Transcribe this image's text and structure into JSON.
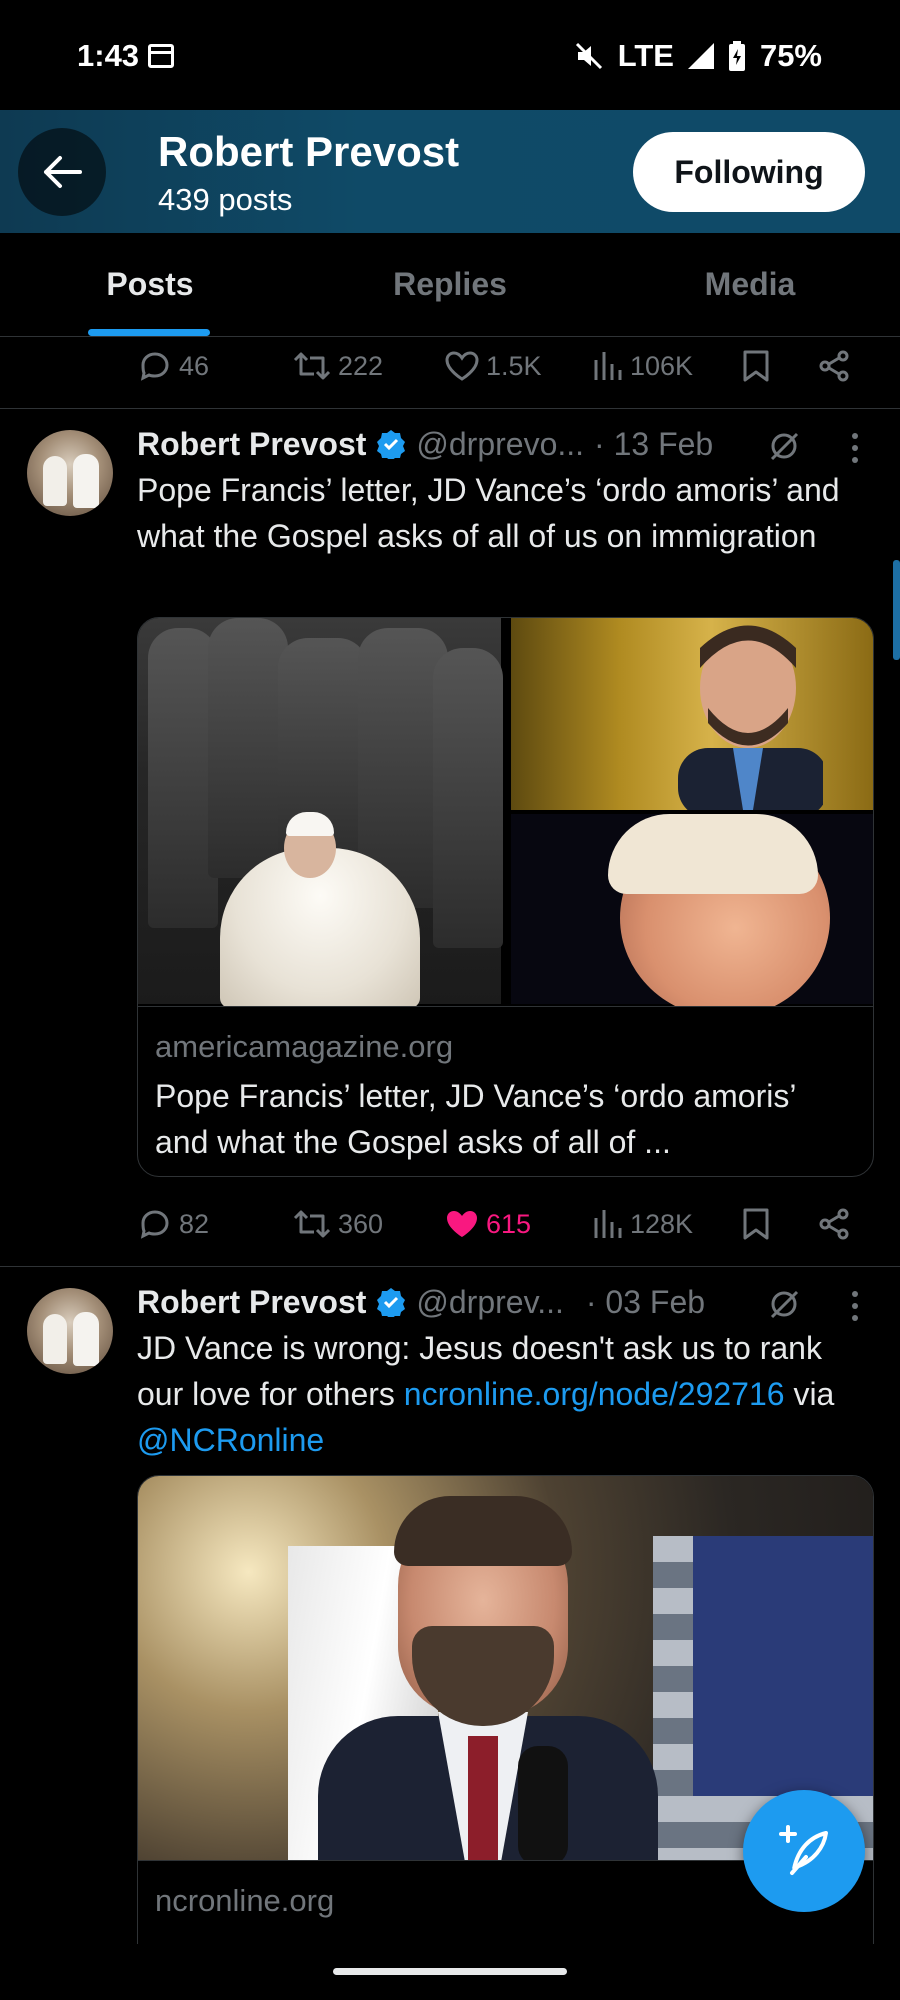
{
  "status_bar": {
    "time": "1:43",
    "network": "LTE",
    "battery": "75%",
    "icons": [
      "calendar-icon",
      "mute-icon",
      "signal-icon",
      "battery-icon"
    ]
  },
  "header": {
    "name": "Robert Prevost",
    "post_count": "439 posts",
    "following_label": "Following"
  },
  "tabs": [
    {
      "label": "Posts",
      "active": true
    },
    {
      "label": "Replies",
      "active": false
    },
    {
      "label": "Media",
      "active": false
    }
  ],
  "top_action_bar": {
    "replies": "46",
    "reposts": "222",
    "likes": "1.5K",
    "views": "106K"
  },
  "tweets": [
    {
      "author": "Robert Prevost",
      "handle": "@drprevo...",
      "date": "· 13 Feb",
      "text": "Pope Francis’ letter, JD Vance’s ‘ordo amoris’ and what the Gospel asks of all of us on immigration",
      "card": {
        "domain": "americamagazine.org",
        "title": "Pope Francis’ letter, JD Vance’s ‘ordo amoris’ and what the Gospel asks of all of ..."
      },
      "actions": {
        "replies": "82",
        "reposts": "360",
        "likes": "615",
        "views": "128K",
        "liked": true
      }
    },
    {
      "author": "Robert Prevost",
      "handle": "@drprev...",
      "date": "· 03 Feb",
      "text_prefix": "JD Vance is wrong: Jesus doesn't ask us to rank our love for others ",
      "text_link": "ncronline.org/node/292716",
      "text_mid": " via ",
      "text_mention": "@NCRonline",
      "card": {
        "domain": "ncronline.org"
      }
    }
  ],
  "colors": {
    "accent": "#1d9bf0",
    "like": "#f91880",
    "muted_text": "#71767b",
    "header_bg": "#0f4a67"
  }
}
